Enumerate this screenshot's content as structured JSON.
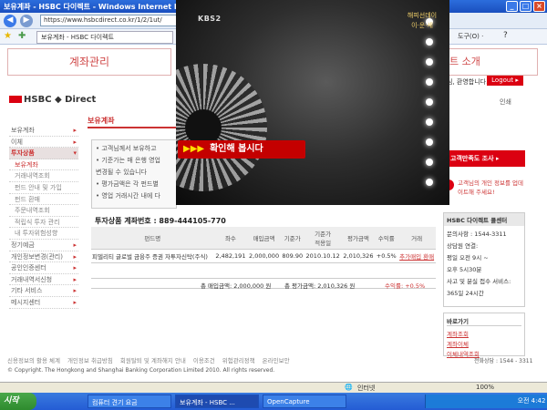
{
  "window": {
    "title": "보유계좌 - HSBC 다이렉트 - Windows Internet E",
    "url": "https://www.hsbcdirect.co.kr/1/2/1ut/",
    "tab_label": "보유계좌 - HSBC 다이렉트",
    "tools_label": "도구(O) ·"
  },
  "page": {
    "banner_left": "계좌관리",
    "banner_right": "트 소개",
    "logo_text": "HSBC ◆ Direct",
    "welcome": "님, 환영합니다.",
    "logout_label": "Logout ▸",
    "print_label": "인쇄"
  },
  "sidebar": {
    "items": [
      {
        "label": "보유계좌",
        "arrow": "▸",
        "style": ""
      },
      {
        "label": "이체",
        "arrow": "▸",
        "style": ""
      },
      {
        "label": "투자상품",
        "arrow": "▾",
        "style": "active"
      },
      {
        "label": "보유계좌",
        "arrow": "",
        "style": "sub activesub"
      },
      {
        "label": "거래내역조회",
        "arrow": "",
        "style": "sub"
      },
      {
        "label": "펀드 안내 및 가입",
        "arrow": "",
        "style": "sub"
      },
      {
        "label": "펀드 환매",
        "arrow": "",
        "style": "sub"
      },
      {
        "label": "주문내역조회",
        "arrow": "",
        "style": "sub"
      },
      {
        "label": "적립식 투자 관리",
        "arrow": "",
        "style": "sub"
      },
      {
        "label": "내 투자위험성향",
        "arrow": "",
        "style": "sub"
      },
      {
        "label": "정기예금",
        "arrow": "▸",
        "style": ""
      },
      {
        "label": "개인정보변경(관리)",
        "arrow": "▸",
        "style": ""
      },
      {
        "label": "공인인증센터",
        "arrow": "▸",
        "style": ""
      },
      {
        "label": "거래내역서신청",
        "arrow": "▸",
        "style": ""
      },
      {
        "label": "기타 서비스",
        "arrow": "▸",
        "style": ""
      },
      {
        "label": "메시지센터",
        "arrow": "▸",
        "style": ""
      }
    ]
  },
  "main": {
    "section_title": "보유계좌",
    "notices": [
      "• 고객님께서 보유하고",
      "• 기준가는 매 은행 영업",
      "  변경될 수 있습니다",
      "• 평가금액은 각 펀드별",
      "• 영업 거래시간 내에 다"
    ],
    "account_title": "투자상품 계좌번호 : 889-444105-770",
    "table": {
      "headers": [
        "펀드명",
        "좌수",
        "매입금액",
        "기준가",
        "기준가\n적용일",
        "평가금액",
        "수익률",
        "거래"
      ],
      "rows": [
        {
          "name": "피델리티 글로벌 금융주 증권 자투자신탁(주식)",
          "units": "2,482,191",
          "purchase": "2,000,000",
          "nav": "809.90",
          "nav_date": "2010.10.12",
          "valuation": "2,010,326",
          "return": "+0.5%",
          "action": "추가매입 환매"
        }
      ]
    },
    "summary": {
      "total_purchase": "총 매입금액: 2,000,000 원",
      "total_valuation": "총 평가금액: 2,010,326 원",
      "return": "수익률: +0.5%"
    }
  },
  "right": {
    "survey_label": "고객만족도 조사 ▸",
    "info_label": "고객님의 개인 정보를 업데이트해 주세요!",
    "info_icon": "!",
    "cs_header": "HSBC 다이렉트 콜센터",
    "cs_lines": [
      "문의사항 : 1544-3311",
      "상담원 연결:",
      "평일 오전 9시 ~",
      "오후 5시30분",
      "사고 및 분실 접수 서비스:",
      "365일 24시간"
    ],
    "quick_header": "바로가기",
    "quick_links": [
      "계좌조회",
      "계좌이체",
      "이체내역조회"
    ]
  },
  "footer": {
    "links": [
      "신용정보의 활용 체계",
      "개인정보 취급방침",
      "회원탈퇴 및 계좌해지 안내",
      "이용조건",
      "위험관리정책",
      "온라인보안"
    ],
    "copyright": "© Copyright. The Hongkong and Shanghai Banking Corporation Limited 2010. All rights reserved.",
    "callcenter": "전화상담 : 1544 - 3311"
  },
  "video": {
    "channel": "KBS2",
    "logo": "해피선데이\n이·운·세",
    "caption_arrows": "▶▶▶",
    "caption": "확인해 봅시다"
  },
  "statusbar": {
    "zone": "인터넷",
    "zoom": "100%"
  },
  "taskbar": {
    "start": "시작",
    "tasks": [
      "컴퓨터 견기 요금",
      "보유계좌 - HSBC ...",
      "OpenCapture"
    ],
    "clock": "오전 4:42"
  }
}
